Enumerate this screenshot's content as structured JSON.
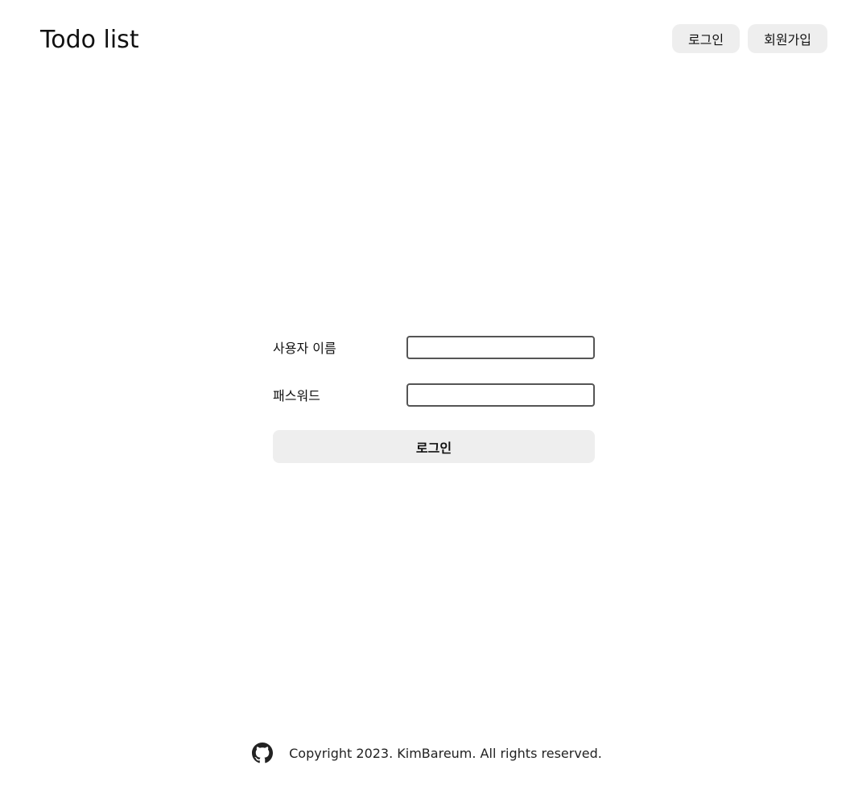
{
  "header": {
    "title": "Todo list",
    "login_label": "로그인",
    "signup_label": "회원가입"
  },
  "form": {
    "username_label": "사용자 이름",
    "username_value": "",
    "password_label": "패스워드",
    "password_value": "",
    "submit_label": "로그인"
  },
  "footer": {
    "icon": "github-icon",
    "copyright": "Copyright 2023. KimBareum. All rights reserved."
  },
  "colors": {
    "button_bg": "#eeeeee",
    "input_border": "#555555",
    "text": "#111111"
  }
}
